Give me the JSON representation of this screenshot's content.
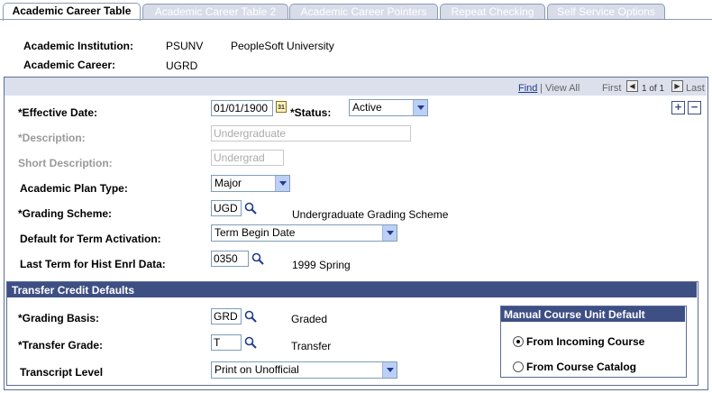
{
  "tabs": [
    {
      "label": "Academic Career Table"
    },
    {
      "label": "Academic Career Table 2"
    },
    {
      "label": "Academic Career Pointers"
    },
    {
      "label": "Repeat Checking"
    },
    {
      "label": "Self Service Options"
    }
  ],
  "header": {
    "institution_label": "Academic Institution:",
    "institution_code": "PSUNV",
    "institution_name": "PeopleSoft University",
    "career_label": "Academic Career:",
    "career_value": "UGRD"
  },
  "nav": {
    "find": "Find",
    "view_all": "View All",
    "first": "First",
    "count": "1 of 1",
    "last": "Last"
  },
  "form": {
    "effective_date_label": "*Effective Date:",
    "effective_date": "01/01/1900",
    "status_label": "*Status:",
    "status": "Active",
    "description_label": "*Description:",
    "description": "Undergraduate",
    "short_desc_label": "Short Description:",
    "short_desc": "Undergrad",
    "plan_type_label": "Academic Plan Type:",
    "plan_type": "Major",
    "grading_label": "*Grading Scheme:",
    "grading_code": "UGD",
    "grading_desc": "Undergraduate Grading Scheme",
    "term_act_label": "Default for Term Activation:",
    "term_act": "Term Begin Date",
    "last_term_label": "Last Term for Hist Enrl Data:",
    "last_term_code": "0350",
    "last_term_desc": "1999 Spring"
  },
  "transfer": {
    "title": "Transfer Credit Defaults",
    "basis_label": "*Grading Basis:",
    "basis_code": "GRD",
    "basis_desc": "Graded",
    "grade_label": "*Transfer Grade:",
    "grade_code": "T",
    "grade_desc": "Transfer",
    "transcript_label": "Transcript Level",
    "transcript": "Print on Unofficial",
    "manual_title": "Manual Course Unit Default",
    "opt_incoming": "From Incoming Course",
    "opt_catalog": "From Course Catalog",
    "selected": "From Incoming Course"
  },
  "colors": {
    "header_bar": "#3e4f84",
    "tab_inactive": "#d8dce8",
    "link": "#1f3a8f"
  }
}
